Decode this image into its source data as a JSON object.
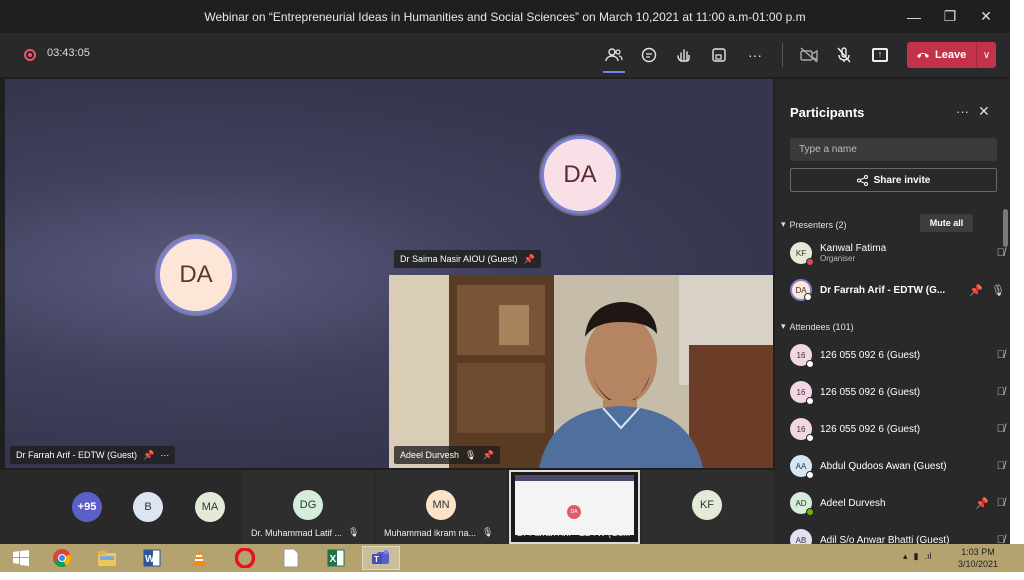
{
  "window": {
    "title": "Webinar on “Entrepreneurial Ideas in Humanities and Social Sciences” on March 10,2021 at 11:00 a.m-01:00 p.m"
  },
  "toolbar": {
    "timer": "03:43:05",
    "leave_label": "Leave"
  },
  "stage": {
    "left_avatar_initials": "DA",
    "right_avatar_initials": "DA",
    "left_name": "Dr Farrah Arif - EDTW (Guest)",
    "right_name": "Dr Saima Nasir AIOU (Guest)",
    "video_name": "Adeel Durvesh"
  },
  "strip": {
    "overflow_count": "+95",
    "tiles": [
      {
        "initials": "B",
        "color": "#dbe6f2"
      },
      {
        "initials": "MA",
        "color": "#e3ead6"
      },
      {
        "initials": "DG",
        "color": "#d5eddb",
        "name": "Dr. Muhammad Latif ..."
      },
      {
        "initials": "MN",
        "color": "#fbe3c8",
        "name": "Muhammad ikram na..."
      },
      {
        "name": "Dr Farrah Arif - EDTW (Gu..."
      },
      {
        "initials": "KF",
        "color": "#e3ead6"
      }
    ]
  },
  "panel": {
    "title": "Participants",
    "search_placeholder": "Type a name",
    "share_invite": "Share invite",
    "presenters_label": "Presenters (2)",
    "mute_all": "Mute all",
    "attendees_label": "Attendees (101)",
    "presenters": [
      {
        "initials": "KF",
        "name": "Kanwal Fatima",
        "role": "Organiser",
        "av_color": "#e3ead6"
      },
      {
        "initials": "DA",
        "name": "Dr Farrah Arif - EDTW (G...",
        "av_color": "#fde6d8"
      }
    ],
    "attendees": [
      {
        "initials": "16",
        "name": "126 055 092 6 (Guest)",
        "av_color": "#f3d6e3"
      },
      {
        "initials": "16",
        "name": "126 055 092 6 (Guest)",
        "av_color": "#f3d6e3"
      },
      {
        "initials": "16",
        "name": "126 055 092 6 (Guest)",
        "av_color": "#f3d6e3"
      },
      {
        "initials": "AA",
        "name": "Abdul Qudoos Awan (Guest)",
        "av_color": "#d5e7f5"
      },
      {
        "initials": "AD",
        "name": "Adeel Durvesh",
        "av_color": "#d5eddb"
      },
      {
        "initials": "AB",
        "name": "Adil S/o Anwar Bhatti (Guest)",
        "av_color": "#e6dff3"
      }
    ]
  },
  "taskbar": {
    "time": "1:03 PM",
    "date": "3/10/2021"
  }
}
